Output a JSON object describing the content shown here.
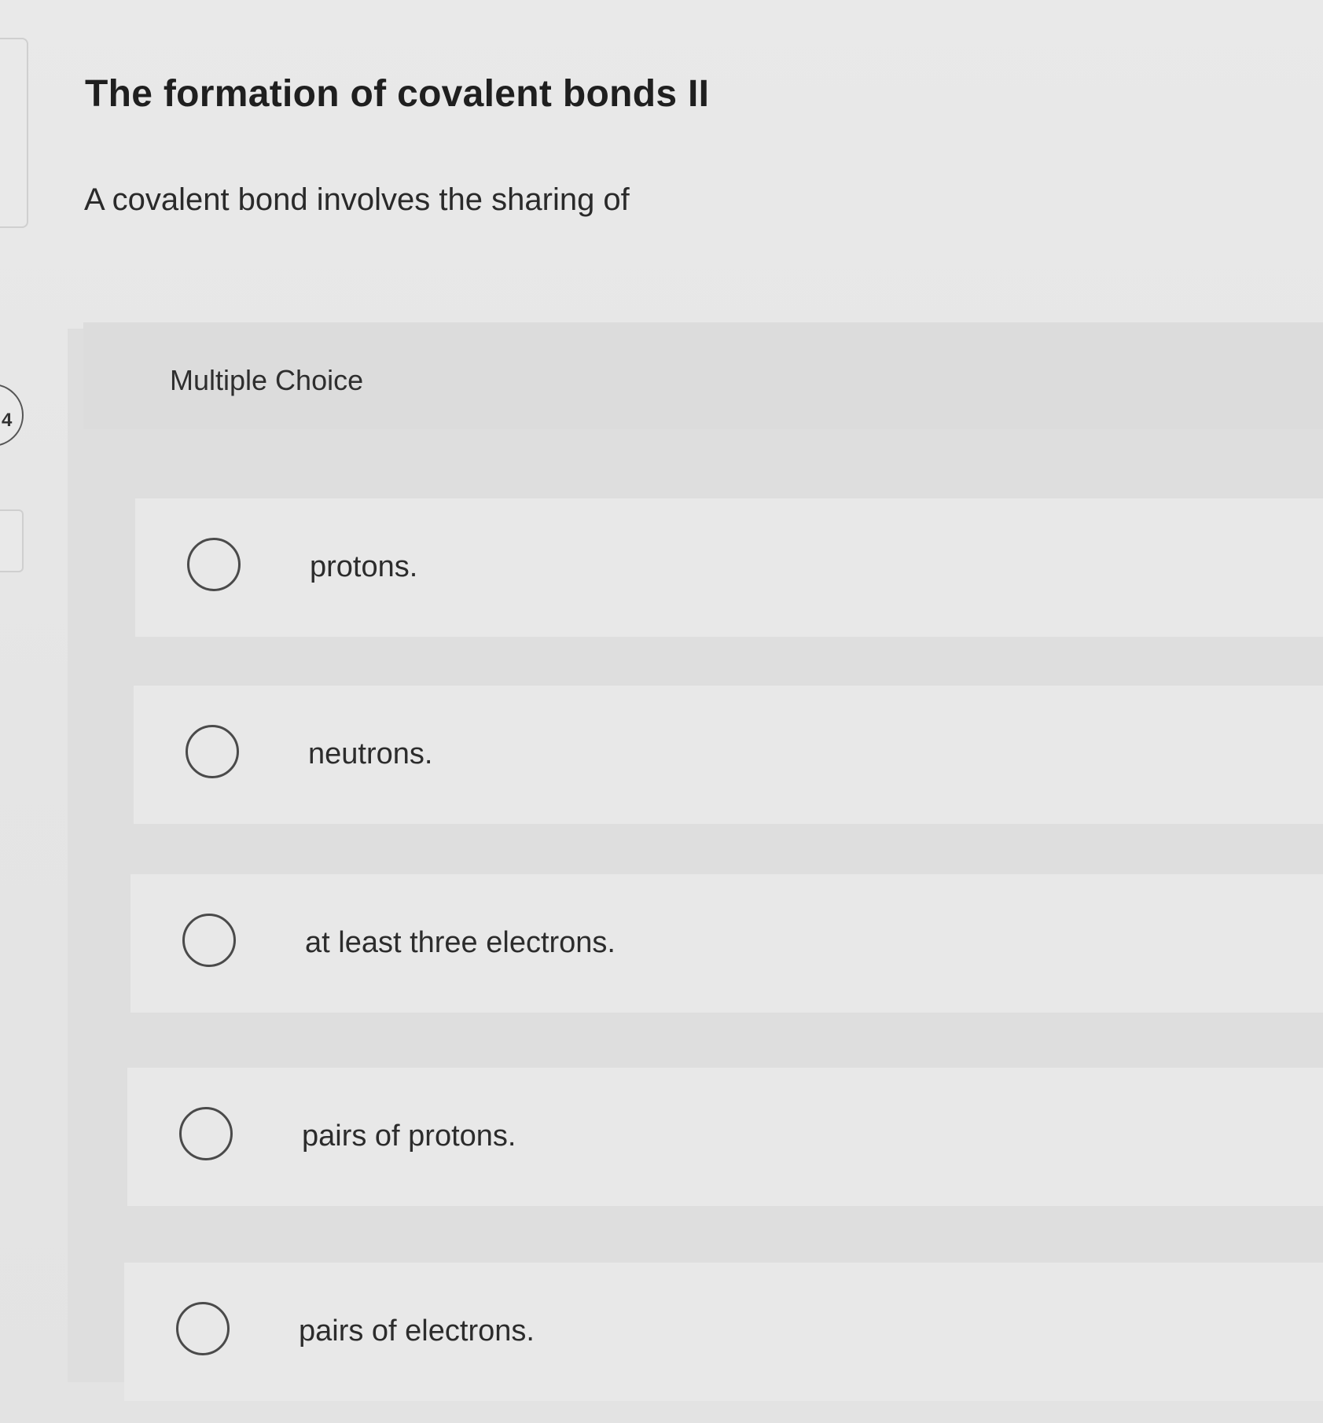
{
  "question": {
    "title": "The formation of covalent bonds II",
    "prompt": "A covalent bond involves the sharing of",
    "number": "4"
  },
  "multiple_choice": {
    "label": "Multiple Choice",
    "options": [
      {
        "label": "protons."
      },
      {
        "label": "neutrons."
      },
      {
        "label": "at least three electrons."
      },
      {
        "label": "pairs of protons."
      },
      {
        "label": "pairs of electrons."
      }
    ]
  }
}
